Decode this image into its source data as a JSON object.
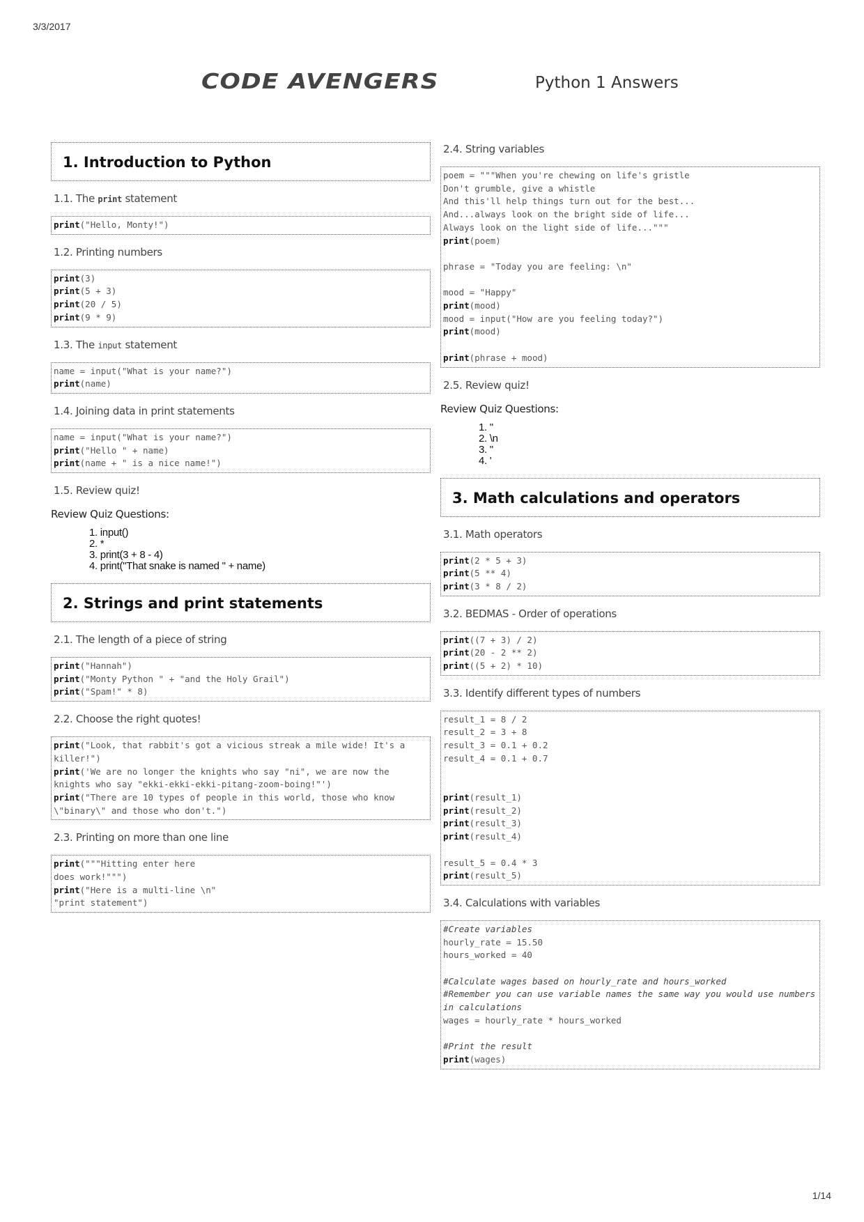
{
  "header": {
    "date": "3/3/2017",
    "logo": "CODE AVENGERS",
    "title": "Python 1 Answers"
  },
  "footer": {
    "page": "1/14"
  },
  "left": {
    "s1": {
      "title": "1. Introduction to Python",
      "sub1_prefix": "1.1. The ",
      "sub1_code": "print",
      "sub1_suffix": " statement",
      "code1": [
        [
          "print",
          "(\"Hello, Monty!\")"
        ]
      ],
      "sub2": "1.2. Printing numbers",
      "code2": [
        [
          "print",
          "(3)"
        ],
        [
          "print",
          "(5 + 3)"
        ],
        [
          "print",
          "(20 / 5)"
        ],
        [
          "print",
          "(9 * 9)"
        ]
      ],
      "sub3_prefix": "1.3. The ",
      "sub3_code": "input",
      "sub3_suffix": " statement",
      "code3": [
        [
          "",
          "name = input(\"What is your name?\")"
        ],
        [
          "print",
          "(name)"
        ]
      ],
      "sub4": "1.4. Joining data in print statements",
      "code4": [
        [
          "",
          "name = input(\"What is your name?\")"
        ],
        [
          "print",
          "(\"Hello \" + name)"
        ],
        [
          "print",
          "(name + \" is a nice name!\")"
        ]
      ],
      "sub5": "1.5. Review quiz!",
      "quiz_label": "Review Quiz Questions:",
      "quiz": [
        "1. input()",
        "2. *",
        "3. print(3 + 8 - 4)",
        "4. print(\"That snake is named \" + name)"
      ]
    },
    "s2": {
      "title": "2. Strings and print statements",
      "sub1": "2.1. The length of a piece of string",
      "code1": [
        [
          "print",
          "(\"Hannah\")"
        ],
        [
          "print",
          "(\"Monty Python \" + \"and the Holy Grail\")"
        ],
        [
          "print",
          "(\"Spam!\" * 8)"
        ]
      ],
      "sub2": "2.2. Choose the right quotes!",
      "code2": [
        [
          "print",
          "(\"Look, that rabbit's got a vicious streak a mile wide! It's a killer!\")"
        ],
        [
          "print",
          "('We are no longer the knights who say \"ni\", we are now the knights who say \"ekki-ekki-ekki-pitang-zoom-boing!\"')"
        ],
        [
          "print",
          "(\"There are 10 types of people in this world, those who know \\\"binary\\\" and those who don't.\")"
        ]
      ],
      "sub3": "2.3. Printing on more than one line",
      "code3": [
        [
          "print",
          "(\"\"\"Hitting enter here\ndoes work!\"\"\")"
        ],
        [
          "print",
          "(\"Here is a multi-line \\n\"\n\"print statement\")"
        ]
      ]
    }
  },
  "right": {
    "s2": {
      "sub4": "2.4. String variables",
      "code4": [
        [
          "",
          "poem = \"\"\"When you're chewing on life's gristle\nDon't grumble, give a whistle\nAnd this'll help things turn out for the best...\nAnd...always look on the bright side of life...\nAlways look on the light side of life...\"\"\""
        ],
        [
          "print",
          "(poem)"
        ],
        [
          "",
          ""
        ],
        [
          "",
          "phrase = \"Today you are feeling: \\n\""
        ],
        [
          "",
          ""
        ],
        [
          "",
          "mood = \"Happy\""
        ],
        [
          "print",
          "(mood)"
        ],
        [
          "",
          "mood = input(\"How are you feeling today?\")"
        ],
        [
          "print",
          "(mood)"
        ],
        [
          "",
          ""
        ],
        [
          "print",
          "(phrase + mood)"
        ]
      ],
      "sub5": "2.5. Review quiz!",
      "quiz_label": "Review Quiz Questions:",
      "quiz": [
        "1. \"",
        "2. \\n",
        "3. \"",
        "4. '"
      ]
    },
    "s3": {
      "title": "3. Math calculations and operators",
      "sub1": "3.1. Math operators",
      "code1": [
        [
          "print",
          "(2 * 5 + 3)"
        ],
        [
          "print",
          "(5 ** 4)"
        ],
        [
          "print",
          "(3 * 8 / 2)"
        ]
      ],
      "sub2": "3.2. BEDMAS - Order of operations",
      "code2": [
        [
          "print",
          "((7 + 3) / 2)"
        ],
        [
          "print",
          "(20 - 2 ** 2)"
        ],
        [
          "print",
          "((5 + 2) * 10)"
        ]
      ],
      "sub3": "3.3. Identify different types of numbers",
      "code3": [
        [
          "",
          "result_1 = 8 / 2"
        ],
        [
          "",
          "result_2 = 3 + 8"
        ],
        [
          "",
          "result_3 = 0.1 + 0.2"
        ],
        [
          "",
          "result_4 = 0.1 + 0.7"
        ],
        [
          "",
          ""
        ],
        [
          "",
          ""
        ],
        [
          "print",
          "(result_1)"
        ],
        [
          "print",
          "(result_2)"
        ],
        [
          "print",
          "(result_3)"
        ],
        [
          "print",
          "(result_4)"
        ],
        [
          "",
          ""
        ],
        [
          "",
          "result_5 = 0.4 * 3"
        ],
        [
          "print",
          "(result_5)"
        ]
      ],
      "sub4": "3.4. Calculations with variables",
      "code4": [
        [
          "#",
          "#Create variables"
        ],
        [
          "",
          "hourly_rate = 15.50"
        ],
        [
          "",
          "hours_worked = 40"
        ],
        [
          "",
          ""
        ],
        [
          "#",
          "#Calculate wages based on hourly_rate and hours_worked"
        ],
        [
          "#",
          "#Remember you can use variable names the same way you would use numbers in calculations"
        ],
        [
          "",
          "wages = hourly_rate * hours_worked"
        ],
        [
          "",
          ""
        ],
        [
          "#",
          "#Print the result"
        ],
        [
          "print",
          "(wages)"
        ]
      ]
    }
  }
}
